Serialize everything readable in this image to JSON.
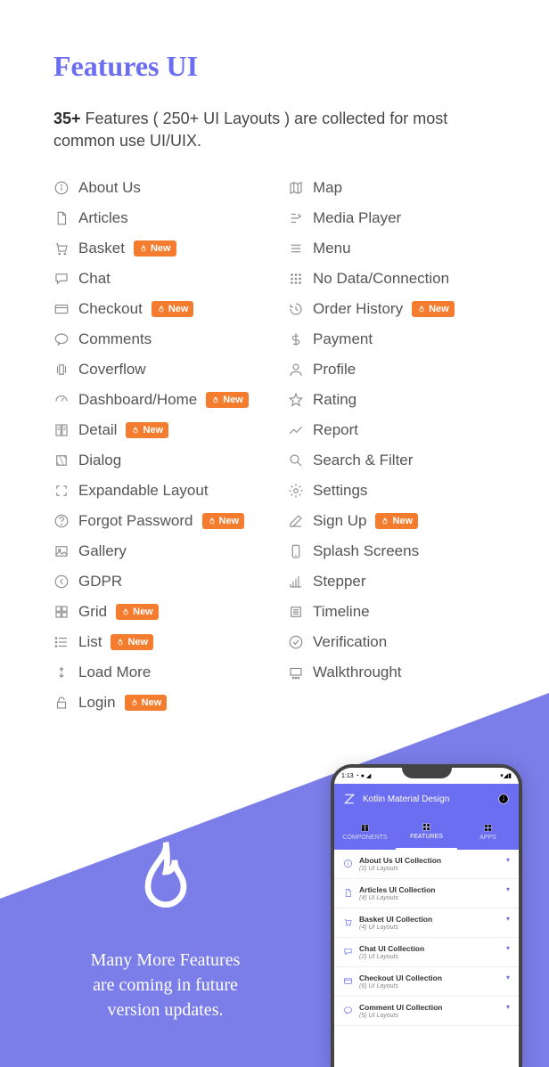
{
  "heading": "Features UI",
  "subtitle_bold": "35+",
  "subtitle_rest": " Features ( 250+ UI Layouts ) are collected for most common use UI/UIX.",
  "new_badge_label": "New",
  "left": [
    {
      "icon": "info",
      "label": "About Us",
      "new": false
    },
    {
      "icon": "file",
      "label": "Articles",
      "new": false
    },
    {
      "icon": "cart",
      "label": "Basket",
      "new": true
    },
    {
      "icon": "chat",
      "label": "Chat",
      "new": false
    },
    {
      "icon": "card",
      "label": "Checkout",
      "new": true
    },
    {
      "icon": "comment",
      "label": "Comments",
      "new": false
    },
    {
      "icon": "coverflow",
      "label": "Coverflow",
      "new": false
    },
    {
      "icon": "dashboard",
      "label": "Dashboard/Home",
      "new": true
    },
    {
      "icon": "book",
      "label": "Detail",
      "new": true
    },
    {
      "icon": "dialog",
      "label": "Dialog",
      "new": false
    },
    {
      "icon": "expand",
      "label": "Expandable Layout",
      "new": false
    },
    {
      "icon": "help",
      "label": "Forgot Password",
      "new": true
    },
    {
      "icon": "image",
      "label": "Gallery",
      "new": false
    },
    {
      "icon": "copyright",
      "label": "GDPR",
      "new": false
    },
    {
      "icon": "grid",
      "label": "Grid",
      "new": true
    },
    {
      "icon": "list",
      "label": "List",
      "new": true
    },
    {
      "icon": "loadmore",
      "label": "Load More",
      "new": false
    },
    {
      "icon": "lock",
      "label": "Login",
      "new": true
    }
  ],
  "right": [
    {
      "icon": "map",
      "label": "Map",
      "new": false
    },
    {
      "icon": "media",
      "label": "Media Player",
      "new": false
    },
    {
      "icon": "menu",
      "label": "Menu",
      "new": false
    },
    {
      "icon": "nodata",
      "label": "No Data/Connection",
      "new": false
    },
    {
      "icon": "history",
      "label": "Order History",
      "new": true
    },
    {
      "icon": "dollar",
      "label": "Payment",
      "new": false
    },
    {
      "icon": "user",
      "label": "Profile",
      "new": false
    },
    {
      "icon": "star",
      "label": "Rating",
      "new": false
    },
    {
      "icon": "chart",
      "label": "Report",
      "new": false
    },
    {
      "icon": "search",
      "label": "Search & Filter",
      "new": false
    },
    {
      "icon": "gear",
      "label": "Settings",
      "new": false
    },
    {
      "icon": "edit",
      "label": "Sign Up",
      "new": true
    },
    {
      "icon": "phone",
      "label": "Splash Screens",
      "new": false
    },
    {
      "icon": "stepper",
      "label": "Stepper",
      "new": false
    },
    {
      "icon": "timeline",
      "label": "Timeline",
      "new": false
    },
    {
      "icon": "check",
      "label": "Verification",
      "new": false
    },
    {
      "icon": "walk",
      "label": "Walkthrought",
      "new": false
    }
  ],
  "bottom_text": "Many More Features\nare coming in future\nversion updates.",
  "phone": {
    "time": "1:13",
    "title": "Kotlin Material Design",
    "tabs": [
      "COMPONENTS",
      "FEATURES",
      "APPS"
    ],
    "collections": [
      {
        "icon": "info",
        "title": "About Us UI Collection",
        "sub": "(2) UI Layouts"
      },
      {
        "icon": "file",
        "title": "Articles UI Collection",
        "sub": "(4) UI Layouts"
      },
      {
        "icon": "cart",
        "title": "Basket UI Collection",
        "sub": "(4) UI Layouts"
      },
      {
        "icon": "chat",
        "title": "Chat UI Collection",
        "sub": "(2) UI Layouts"
      },
      {
        "icon": "card",
        "title": "Checkout UI Collection",
        "sub": "(6) UI Layouts"
      },
      {
        "icon": "comment",
        "title": "Comment UI Collection",
        "sub": "(5) UI Layouts"
      }
    ]
  }
}
